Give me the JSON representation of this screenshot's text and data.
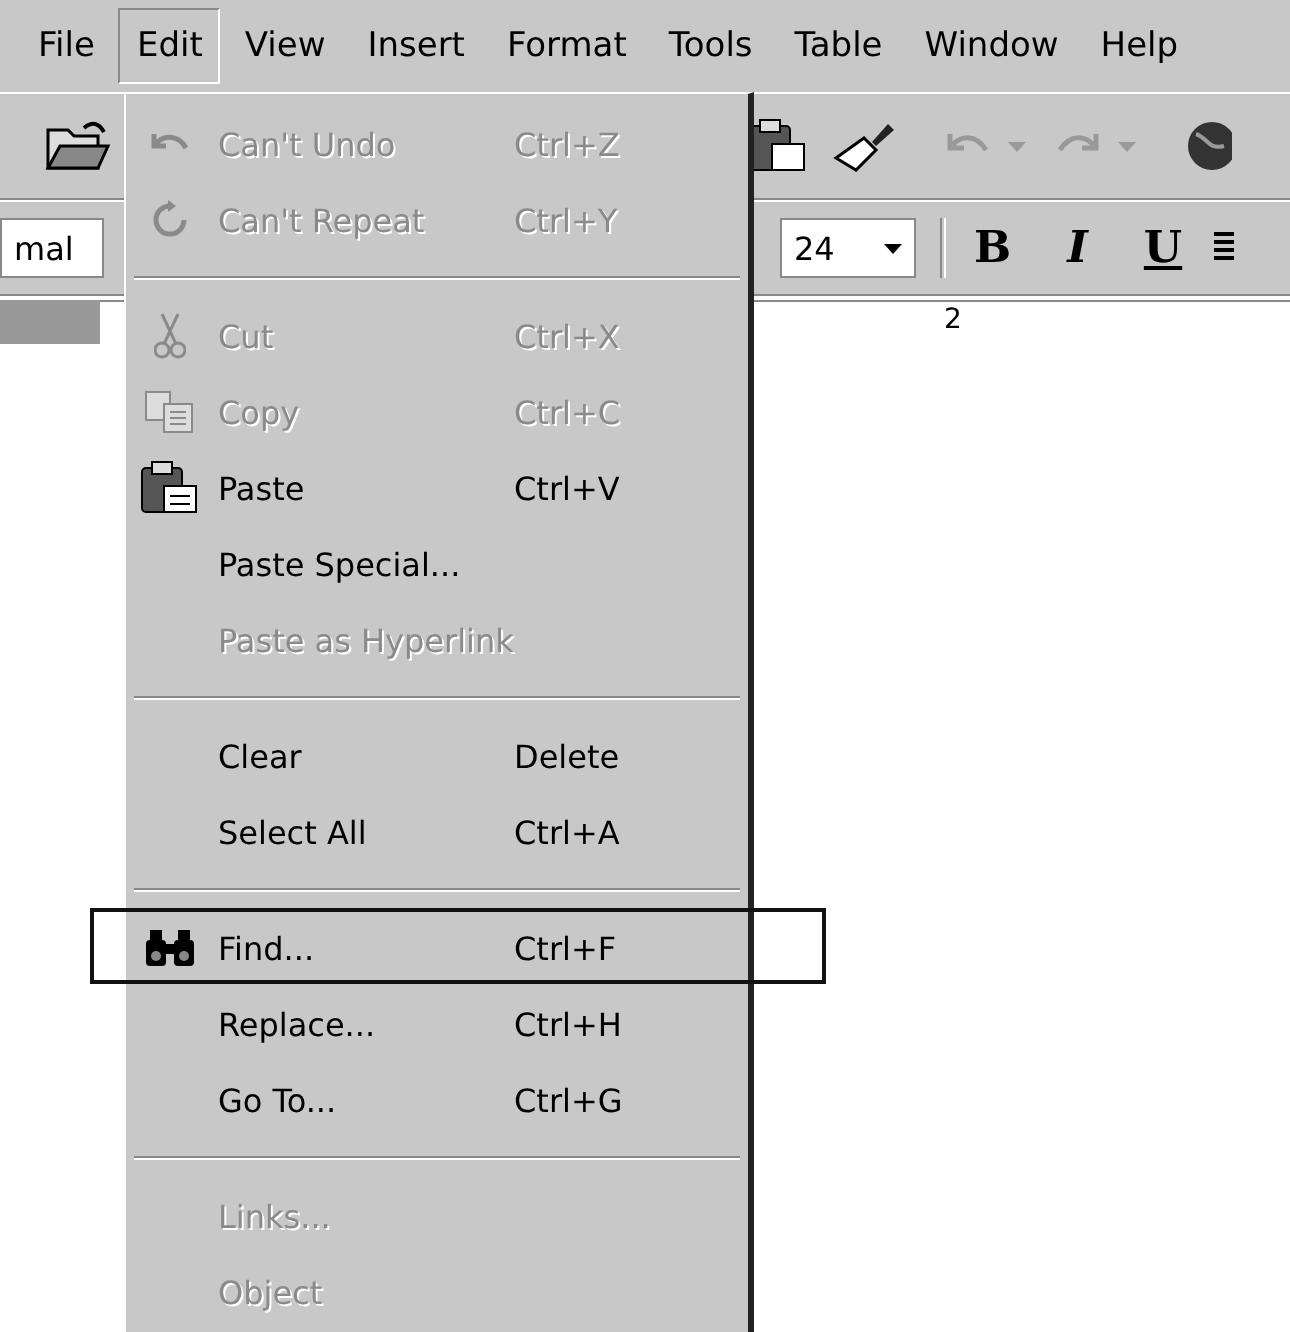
{
  "menu_bar": [
    {
      "label": "File",
      "selected": false
    },
    {
      "label": "Edit",
      "selected": true
    },
    {
      "label": "View",
      "selected": false
    },
    {
      "label": "Insert",
      "selected": false
    },
    {
      "label": "Format",
      "selected": false
    },
    {
      "label": "Tools",
      "selected": false
    },
    {
      "label": "Table",
      "selected": false
    },
    {
      "label": "Window",
      "selected": false
    },
    {
      "label": "Help",
      "selected": false
    }
  ],
  "format_bar": {
    "style": "mal",
    "font_size": "24",
    "buttons": [
      "B",
      "I",
      "U"
    ]
  },
  "ruler": {
    "label": "2"
  },
  "edit_menu": {
    "items": [
      {
        "kind": "item",
        "label": "Can't Undo",
        "shortcut": "Ctrl+Z",
        "disabled": true
      },
      {
        "kind": "item",
        "label": "Can't Repeat",
        "shortcut": "Ctrl+Y",
        "disabled": true
      },
      {
        "kind": "separator"
      },
      {
        "kind": "item",
        "label": "Cut",
        "shortcut": "Ctrl+X",
        "disabled": true
      },
      {
        "kind": "item",
        "label": "Copy",
        "shortcut": "Ctrl+C",
        "disabled": true
      },
      {
        "kind": "item",
        "label": "Paste",
        "shortcut": "Ctrl+V",
        "disabled": false
      },
      {
        "kind": "item",
        "label": "Paste Special...",
        "disabled": false
      },
      {
        "kind": "item",
        "label": "Paste as Hyperlink",
        "disabled": true
      },
      {
        "kind": "separator"
      },
      {
        "kind": "item",
        "label": "Clear",
        "shortcut": "Delete",
        "disabled": false
      },
      {
        "kind": "item",
        "label": "Select All",
        "shortcut": "Ctrl+A",
        "disabled": false
      },
      {
        "kind": "separator"
      },
      {
        "kind": "item",
        "label": "Find...",
        "shortcut": "Ctrl+F",
        "disabled": false,
        "outlined": true
      },
      {
        "kind": "item",
        "label": "Replace...",
        "shortcut": "Ctrl+H",
        "disabled": false
      },
      {
        "kind": "item",
        "label": "Go To...",
        "shortcut": "Ctrl+G",
        "disabled": false
      },
      {
        "kind": "separator"
      },
      {
        "kind": "item",
        "label": "Links...",
        "disabled": true
      },
      {
        "kind": "item",
        "label": "Object",
        "disabled": true
      }
    ]
  }
}
